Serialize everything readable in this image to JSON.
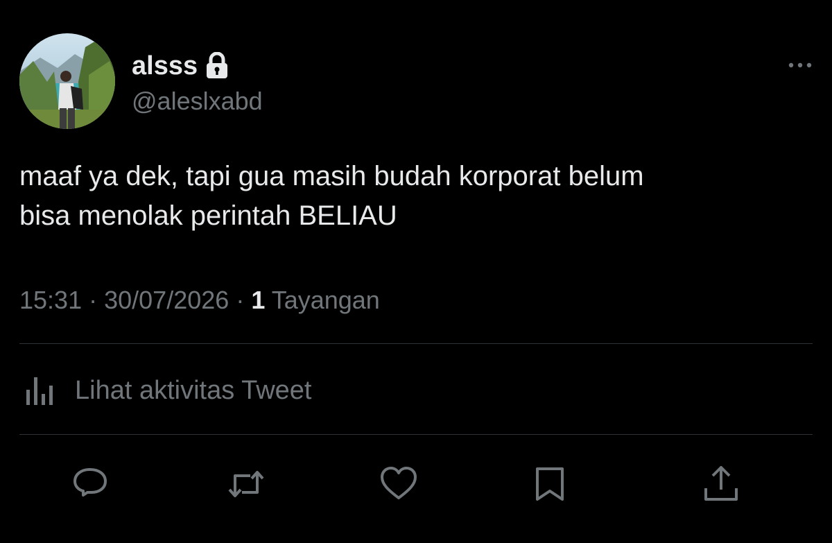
{
  "user": {
    "display_name": "alsss",
    "handle": "@aleslxabd",
    "protected_icon": "lock-icon",
    "avatar": "avatar-photo"
  },
  "tweet": {
    "text_line_1": "maaf ya dek, tapi gua masih budah korporat belum",
    "text_line_2": "bisa menolak perintah BELIAU",
    "time": "15:31",
    "date": "30/07/2026",
    "separator": "·",
    "views_count": "1",
    "views_label": "Tayangan"
  },
  "activity": {
    "icon": "bar-chart-icon",
    "label": "Lihat aktivitas Tweet"
  },
  "actions": [
    {
      "name": "reply",
      "icon": "reply-icon"
    },
    {
      "name": "retweet",
      "icon": "retweet-icon"
    },
    {
      "name": "like",
      "icon": "heart-icon"
    },
    {
      "name": "bookmark",
      "icon": "bookmark-icon"
    },
    {
      "name": "share",
      "icon": "share-icon"
    }
  ],
  "colors": {
    "background": "#000000",
    "primary_text": "#e7e9ea",
    "secondary_text": "#71767b",
    "divider": "#2f3336"
  }
}
